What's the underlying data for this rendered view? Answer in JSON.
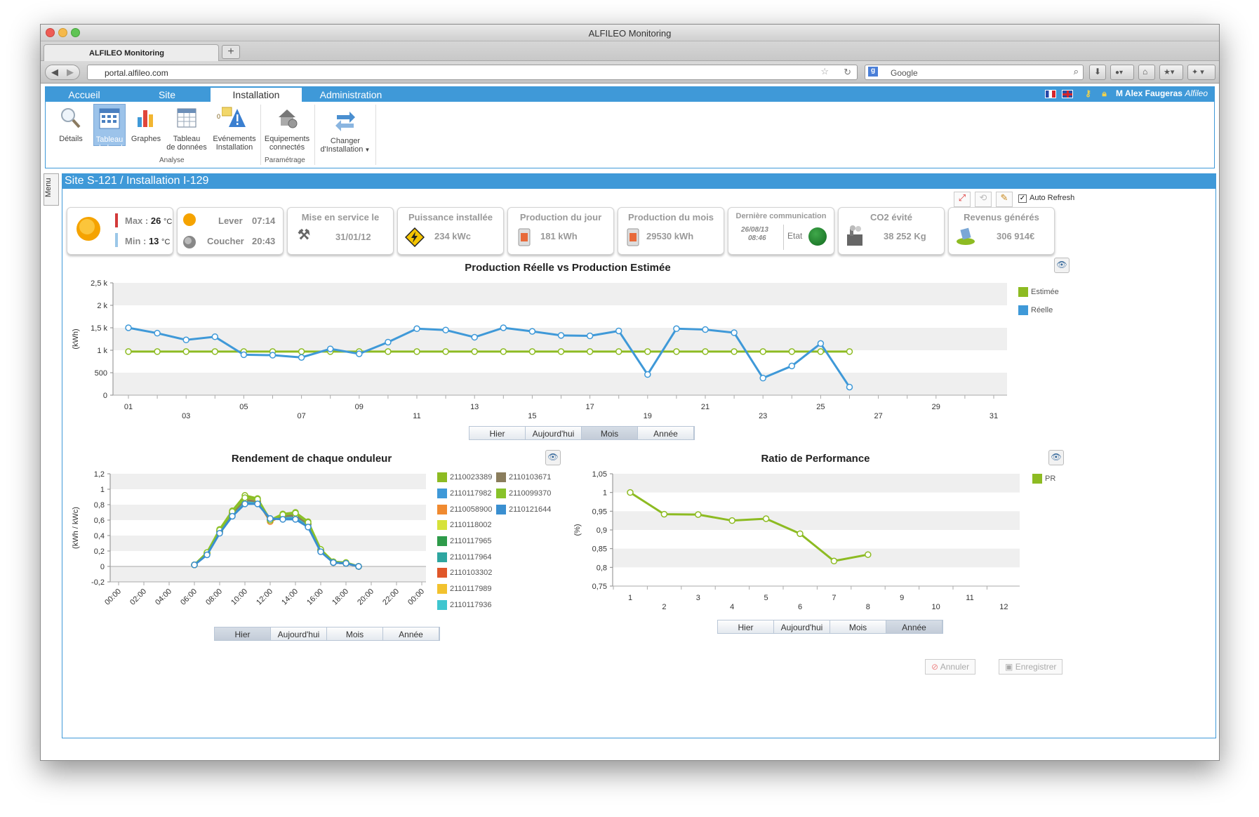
{
  "browser": {
    "window_title": "ALFILEO Monitoring",
    "tab_title": "ALFILEO Monitoring",
    "url": "portal.alfileo.com",
    "search_placeholder": "Google"
  },
  "menu": {
    "tabs": [
      "Accueil",
      "Site",
      "Installation",
      "Administration"
    ],
    "active": "Installation",
    "user_name": "M Alex Faugeras",
    "user_org": "Alfileo"
  },
  "ribbon": {
    "items": [
      {
        "l1": "Détails",
        "l2": ""
      },
      {
        "l1": "Tableau",
        "l2": "de bord"
      },
      {
        "l1": "Graphes",
        "l2": ""
      },
      {
        "l1": "Tableau",
        "l2": "de données"
      },
      {
        "l1": "Evénements",
        "l2": "Installation"
      },
      {
        "l1": "Equipements",
        "l2": "connectés"
      },
      {
        "l1": "Changer",
        "l2": "d'Installation"
      }
    ],
    "event_badge": "0",
    "group_analyse": "Analyse",
    "group_param": "Paramétrage"
  },
  "side_menu": "Menu",
  "site_title": "Site S-121 / Installation I-129",
  "auto_refresh": "Auto Refresh",
  "cards": {
    "temp_max_label": "Max :",
    "temp_max": "26",
    "temp_min_label": "Min :",
    "temp_min": "13",
    "temp_unit": "°C",
    "lever_label": "Lever",
    "lever": "07:14",
    "coucher_label": "Coucher",
    "coucher": "20:43",
    "mise_label": "Mise en service le",
    "mise": "31/01/12",
    "puissance_label": "Puissance installée",
    "puissance": "234  kWc",
    "prod_jour_label": "Production du jour",
    "prod_jour": "181  kWh",
    "prod_mois_label": "Production du mois",
    "prod_mois": "29530  kWh",
    "comm_label": "Dernière communication",
    "comm_date": "26/08/13",
    "comm_time": "08:46",
    "etat_label": "Etat",
    "co2_label": "CO2 évité",
    "co2": "38 252 Kg",
    "revenus_label": "Revenus générés",
    "revenus": "306 914€"
  },
  "buttons": {
    "annuler": "Annuler",
    "enregistrer": "Enregistrer"
  },
  "periods": [
    "Hier",
    "Aujourd'hui",
    "Mois",
    "Année"
  ],
  "chart_data": [
    {
      "type": "line",
      "title": "Production Réelle vs Production Estimée",
      "ylabel": "(kWh)",
      "ylim": [
        0,
        2500
      ],
      "yticks": [
        "0",
        "500",
        "1 k",
        "1,5 k",
        "2 k",
        "2,5 k"
      ],
      "x": [
        1,
        2,
        3,
        4,
        5,
        6,
        7,
        8,
        9,
        10,
        11,
        12,
        13,
        14,
        15,
        16,
        17,
        18,
        19,
        20,
        21,
        22,
        23,
        24,
        25,
        26
      ],
      "xticks": [
        "01",
        "03",
        "05",
        "07",
        "09",
        "11",
        "13",
        "15",
        "17",
        "19",
        "21",
        "23",
        "25",
        "27",
        "29",
        "31"
      ],
      "series": [
        {
          "name": "Estimée",
          "color": "#8dbb22",
          "values": [
            970,
            970,
            970,
            970,
            970,
            970,
            970,
            970,
            970,
            970,
            970,
            970,
            970,
            970,
            970,
            970,
            970,
            970,
            970,
            970,
            970,
            970,
            970,
            970,
            970,
            970
          ]
        },
        {
          "name": "Réelle",
          "color": "#3f99d8",
          "values": [
            1500,
            1380,
            1230,
            1300,
            900,
            890,
            840,
            1030,
            920,
            1180,
            1480,
            1450,
            1290,
            1500,
            1420,
            1330,
            1320,
            1430,
            460,
            1480,
            1460,
            1390,
            380,
            650,
            1150,
            180
          ]
        }
      ],
      "active_period": "Mois"
    },
    {
      "type": "line",
      "title": "Rendement de chaque onduleur",
      "ylabel": "(kWh / kWc)",
      "ylim": [
        -0.2,
        1.2
      ],
      "yticks": [
        "-0,2",
        "0",
        "0,2",
        "0,4",
        "0,6",
        "0,8",
        "1",
        "1,2"
      ],
      "xticks": [
        "00:00",
        "02:00",
        "04:00",
        "06:00",
        "08:00",
        "10:00",
        "12:00",
        "14:00",
        "16:00",
        "18:00",
        "20:00",
        "22:00",
        "00:00"
      ],
      "x": [
        6,
        7,
        8,
        9,
        10,
        11,
        12,
        13,
        14,
        15,
        16,
        17,
        18,
        19
      ],
      "series": [
        {
          "name": "2110023389",
          "color": "#8dbb22",
          "values": [
            0.02,
            0.18,
            0.48,
            0.72,
            0.92,
            0.88,
            0.6,
            0.68,
            0.7,
            0.58,
            0.22,
            0.06,
            0.05,
            0.0
          ]
        },
        {
          "name": "2110117982",
          "color": "#3f99d8",
          "values": [
            0.02,
            0.16,
            0.44,
            0.66,
            0.82,
            0.82,
            0.62,
            0.62,
            0.62,
            0.52,
            0.2,
            0.05,
            0.04,
            0.0
          ]
        },
        {
          "name": "2110058900",
          "color": "#f08a30",
          "values": [
            0.02,
            0.17,
            0.46,
            0.7,
            0.86,
            0.85,
            0.58,
            0.66,
            0.66,
            0.55,
            0.21,
            0.05,
            0.04,
            0.0
          ]
        },
        {
          "name": "2110118002",
          "color": "#d6e23a",
          "values": [
            0.02,
            0.18,
            0.47,
            0.71,
            0.88,
            0.86,
            0.6,
            0.67,
            0.68,
            0.56,
            0.22,
            0.06,
            0.05,
            0.0
          ]
        },
        {
          "name": "2110117965",
          "color": "#2e9b4a",
          "values": [
            0.02,
            0.17,
            0.46,
            0.69,
            0.86,
            0.84,
            0.6,
            0.65,
            0.66,
            0.55,
            0.21,
            0.05,
            0.04,
            0.0
          ]
        },
        {
          "name": "2110117964",
          "color": "#2ea6a0",
          "values": [
            0.02,
            0.16,
            0.45,
            0.68,
            0.85,
            0.83,
            0.6,
            0.64,
            0.65,
            0.54,
            0.2,
            0.05,
            0.04,
            0.0
          ]
        },
        {
          "name": "2110103302",
          "color": "#e0572a",
          "values": [
            0.02,
            0.17,
            0.45,
            0.69,
            0.86,
            0.84,
            0.6,
            0.65,
            0.66,
            0.55,
            0.21,
            0.05,
            0.04,
            0.0
          ]
        },
        {
          "name": "2110117989",
          "color": "#f2c22e",
          "values": [
            0.02,
            0.17,
            0.46,
            0.7,
            0.87,
            0.85,
            0.6,
            0.66,
            0.67,
            0.55,
            0.21,
            0.05,
            0.04,
            0.0
          ]
        },
        {
          "name": "2110117936",
          "color": "#3fc6cf",
          "values": [
            0.02,
            0.16,
            0.45,
            0.68,
            0.85,
            0.83,
            0.61,
            0.64,
            0.65,
            0.54,
            0.2,
            0.05,
            0.04,
            0.0
          ]
        },
        {
          "name": "2110103671",
          "color": "#8a7d5c",
          "values": [
            0.02,
            0.17,
            0.46,
            0.69,
            0.86,
            0.84,
            0.6,
            0.65,
            0.66,
            0.55,
            0.21,
            0.05,
            0.04,
            0.0
          ]
        },
        {
          "name": "2110099370",
          "color": "#88c22a",
          "values": [
            0.02,
            0.18,
            0.47,
            0.71,
            0.89,
            0.87,
            0.6,
            0.67,
            0.69,
            0.57,
            0.22,
            0.06,
            0.05,
            0.0
          ]
        },
        {
          "name": "2110121644",
          "color": "#3a8fd0",
          "values": [
            0.02,
            0.15,
            0.43,
            0.65,
            0.81,
            0.81,
            0.62,
            0.61,
            0.61,
            0.51,
            0.19,
            0.05,
            0.04,
            0.0
          ]
        }
      ],
      "active_period": "Hier"
    },
    {
      "type": "line",
      "title": "Ratio de Performance",
      "ylabel": "(%)",
      "ylim": [
        0.75,
        1.05
      ],
      "yticks": [
        "0,75",
        "0,8",
        "0,85",
        "0,9",
        "0,95",
        "1",
        "1,05"
      ],
      "xticks": [
        "1",
        "2",
        "3",
        "4",
        "5",
        "6",
        "7",
        "8",
        "9",
        "10",
        "11",
        "12"
      ],
      "x": [
        1,
        2,
        3,
        4,
        5,
        6,
        7,
        8
      ],
      "series": [
        {
          "name": "PR",
          "color": "#8dbb22",
          "values": [
            1.0,
            0.942,
            0.941,
            0.925,
            0.93,
            0.89,
            0.817,
            0.834
          ]
        }
      ],
      "active_period": "Année"
    }
  ]
}
